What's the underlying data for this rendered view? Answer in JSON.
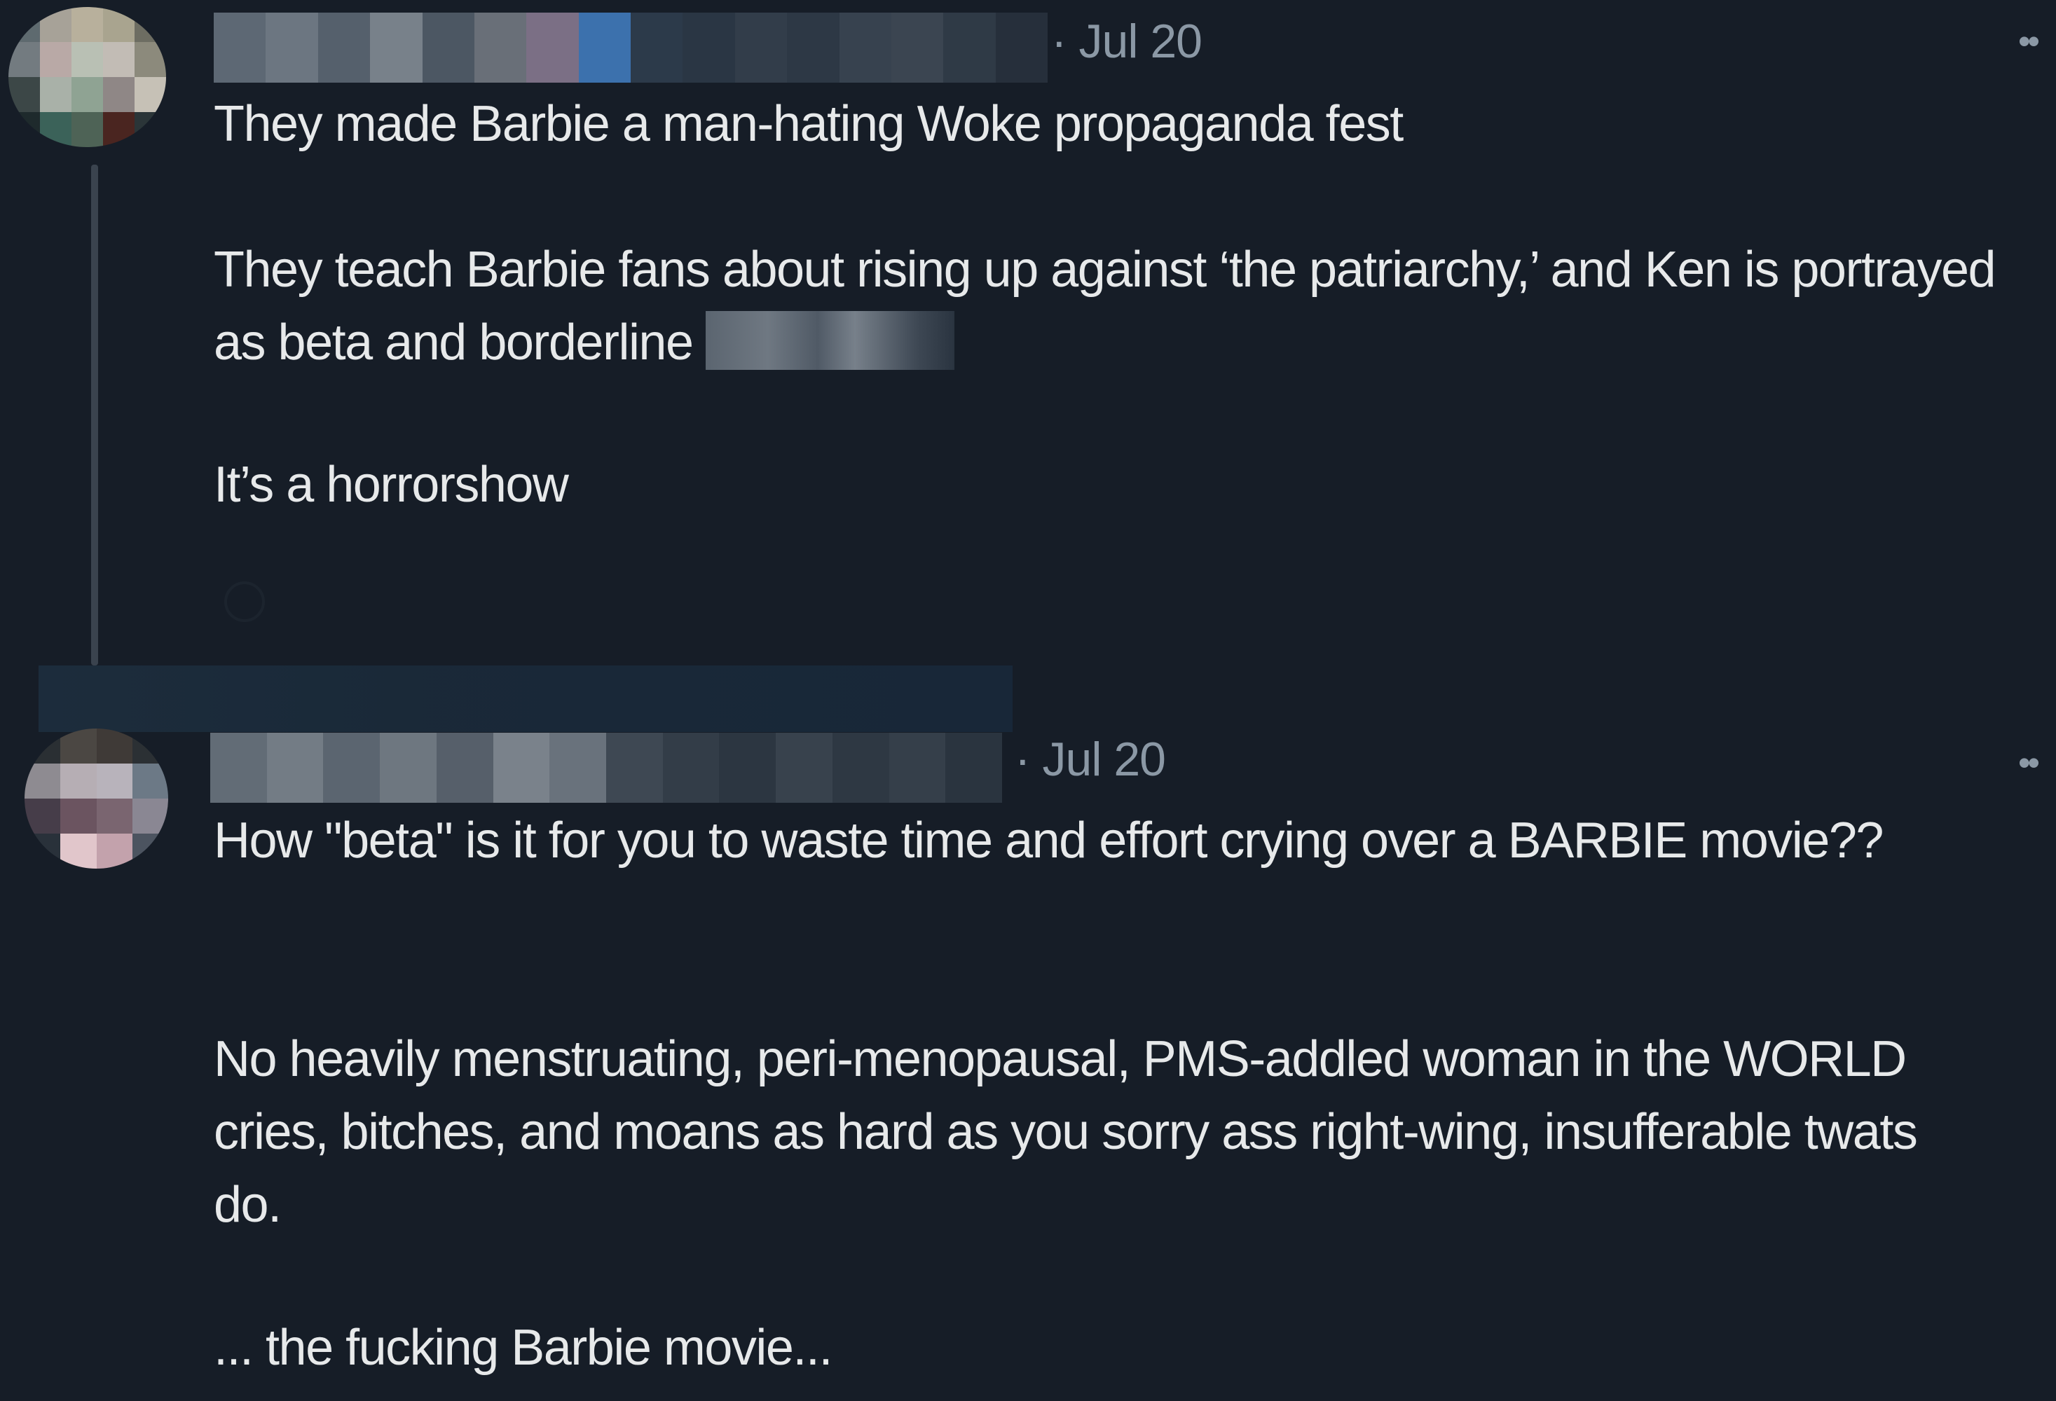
{
  "tweets": [
    {
      "date": "· Jul 20",
      "more": "••",
      "text": {
        "line1": "They made Barbie a man-hating Woke propaganda fest",
        "para2": "They teach Barbie fans about rising up against ‘the patriarchy,’ and Ken is portrayed as beta and borderline",
        "para3": "It’s a horrorshow"
      }
    },
    {
      "date": "· Jul 20",
      "more": "••",
      "text": {
        "para1": "How \"beta\" is it for you to waste time and effort crying over a BARBIE movie??",
        "para2": "No heavily menstruating, peri-menopausal, PMS-addled woman in the WORLD cries, bitches, and moans as hard as you sorry ass right-wing, insufferable twats do.",
        "para3": "... the fucking Barbie movie..."
      }
    }
  ],
  "colors": {
    "background": "#161d27",
    "text_primary": "#e7e9ea",
    "text_secondary": "#8b98a5",
    "thread_line": "#3a434e"
  },
  "icons": {
    "more": "more-options-icon",
    "reply": "reply-icon"
  }
}
